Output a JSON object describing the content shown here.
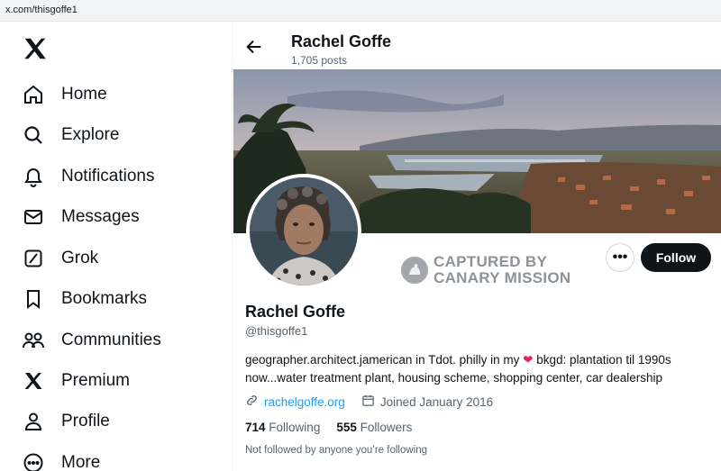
{
  "browser": {
    "url": "x.com/thisgoffe1"
  },
  "sidebar": {
    "items": [
      {
        "label": "Home",
        "icon": "home-icon"
      },
      {
        "label": "Explore",
        "icon": "search-icon"
      },
      {
        "label": "Notifications",
        "icon": "bell-icon"
      },
      {
        "label": "Messages",
        "icon": "envelope-icon"
      },
      {
        "label": "Grok",
        "icon": "grok-icon"
      },
      {
        "label": "Bookmarks",
        "icon": "bookmark-icon"
      },
      {
        "label": "Communities",
        "icon": "people-icon"
      },
      {
        "label": "Premium",
        "icon": "x-logo-icon"
      },
      {
        "label": "Profile",
        "icon": "person-icon"
      },
      {
        "label": "More",
        "icon": "more-circle-icon"
      }
    ]
  },
  "header": {
    "name": "Rachel Goffe",
    "posts": "1,705 posts"
  },
  "watermark": {
    "line1": "CAPTURED BY",
    "line2": "CANARY MISSION"
  },
  "actions": {
    "more": "•••",
    "follow": "Follow"
  },
  "profile": {
    "name": "Rachel Goffe",
    "handle": "@thisgoffe1",
    "bio_part1": "geographer.architect.jamerican in Tdot. philly in my",
    "bio_heart": "❤",
    "bio_part2": "bkgd: plantation til 1990s now...water treatment plant, housing scheme, shopping center, car dealership",
    "website": "rachelgoffe.org",
    "joined": "Joined January 2016",
    "following_count": "714",
    "following_label": "Following",
    "followers_count": "555",
    "followers_label": "Followers",
    "not_followed": "Not followed by anyone you’re following"
  },
  "colors": {
    "accent": "#1d9bf0",
    "text": "#0f1419",
    "muted": "#536471",
    "heart": "#e0245e"
  }
}
